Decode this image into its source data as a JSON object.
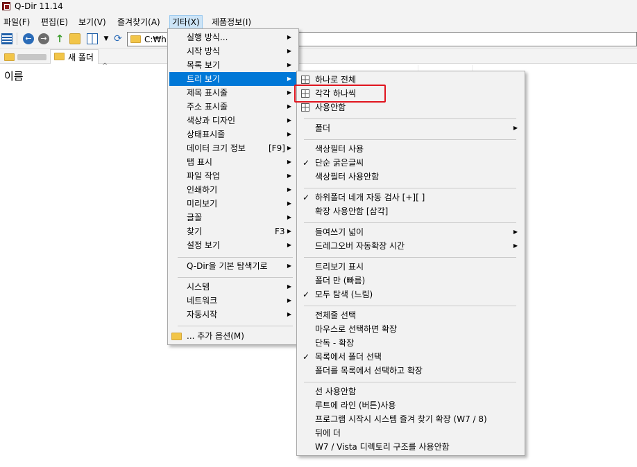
{
  "window": {
    "title": "Q-Dir 11.14"
  },
  "menubar": {
    "items": [
      "파일(F)",
      "편집(E)",
      "보기(V)",
      "즐겨찾기(A)",
      "기타(X)",
      "제품정보(I)"
    ]
  },
  "toolbar": {
    "icons": [
      "list-view-icon",
      "back-icon",
      "forward-icon",
      "up-icon",
      "new-folder-icon",
      "view-mode-icon",
      "dropdown-icon",
      "refresh-icon"
    ],
    "back_glyph": "←",
    "forward_glyph": "→",
    "up_glyph": "↑",
    "dropdown_glyph": "▼",
    "refresh_glyph": "⟳",
    "address": "C:₩hr"
  },
  "tabs": {
    "current": "새 폴더"
  },
  "file_list": {
    "column_name": "이름",
    "sort_glyph": "^"
  },
  "menu_other": {
    "items": [
      {
        "label": "실행 방식...",
        "arrow": "▶"
      },
      {
        "label": "시작 방식",
        "arrow": "▶"
      },
      {
        "label": "목록 보기",
        "arrow": "▶"
      },
      {
        "label": "트리 보기",
        "arrow": "▶"
      },
      {
        "label": "제목 표시줄",
        "arrow": "▶"
      },
      {
        "label": "주소 표시줄",
        "arrow": "▶"
      },
      {
        "label": "색상과 디자인",
        "arrow": "▶"
      },
      {
        "label": "상태표시줄",
        "arrow": "▶"
      },
      {
        "label": "데이터 크기 정보",
        "shortcut": "[F9]",
        "arrow": "▶"
      },
      {
        "label": "탭 표시",
        "arrow": "▶"
      },
      {
        "label": "파일 작업",
        "arrow": "▶"
      },
      {
        "label": "인쇄하기",
        "arrow": "▶"
      },
      {
        "label": "미리보기",
        "arrow": "▶"
      },
      {
        "label": "글꼴",
        "arrow": "▶"
      },
      {
        "label": "찾기",
        "shortcut": "F3",
        "arrow": "▶"
      },
      {
        "label": "설정 보기",
        "arrow": "▶"
      },
      {
        "label": "Q-Dir을 기본 탐색기로",
        "arrow": "▶"
      },
      {
        "label": "시스템",
        "arrow": "▶"
      },
      {
        "label": "네트워크",
        "arrow": "▶"
      },
      {
        "label": "자동시작",
        "arrow": "▶"
      },
      {
        "label": "... 추가 옵션(M)"
      }
    ]
  },
  "menu_tree": {
    "items": [
      {
        "label": "하나로 전체"
      },
      {
        "label": "각각 하나씩"
      },
      {
        "label": "사용안함"
      },
      {
        "label": "폴더",
        "arrow": "▶"
      },
      {
        "label": "색상필터 사용"
      },
      {
        "label": "단순 굵은글씨",
        "check": "✓"
      },
      {
        "label": "색상필터 사용안함"
      },
      {
        "label": "하위폴더 네개 자동 검사 [+][ ]",
        "check": "✓"
      },
      {
        "label": "확장 사용안함 [삼각]"
      },
      {
        "label": "들여쓰기 넓이",
        "arrow": "▶"
      },
      {
        "label": "드레그오버 자동확장 시간",
        "arrow": "▶"
      },
      {
        "label": "트리보기 표시"
      },
      {
        "label": "폴더 만 (빠름)"
      },
      {
        "label": "모두 탐색 (느림)",
        "check": "✓"
      },
      {
        "label": "전체줄 선택"
      },
      {
        "label": "마우스로 선택하면 확장"
      },
      {
        "label": "단독 - 확장"
      },
      {
        "label": "목록에서 폴더 선택",
        "check": "✓"
      },
      {
        "label": "폴더를 목록에서 선택하고 확장"
      },
      {
        "label": "선 사용안함"
      },
      {
        "label": "루트에 라인 (버튼)사용"
      },
      {
        "label": "프로그램 시작시 시스템 즐겨 찾기 확장 (W7 / 8)"
      },
      {
        "label": "뒤에 더"
      },
      {
        "label": "W7 / Vista 디렉토리 구조를 사용안함"
      }
    ]
  },
  "colors": {
    "highlight": "#0078d7",
    "annotation_box": "#e0141e",
    "menu_bg": "#f2f2f2"
  }
}
